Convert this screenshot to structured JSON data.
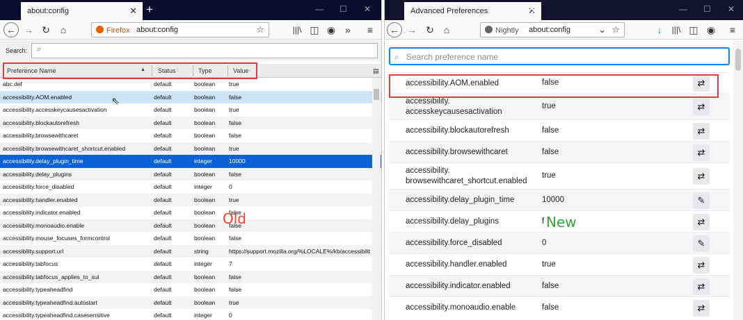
{
  "left": {
    "tab_title": "about:config",
    "brand": "Firefox",
    "url": "about:config",
    "search_label": "Search:",
    "columns": [
      "Preference Name",
      "Status",
      "Type",
      "Value"
    ],
    "rows": [
      [
        "abc.def",
        "default",
        "boolean",
        "true"
      ],
      [
        "accessibility.AOM.enabled",
        "default",
        "boolean",
        "false"
      ],
      [
        "accessibility.accesskeycausesactivation",
        "default",
        "boolean",
        "true"
      ],
      [
        "accessibility.blockautorefresh",
        "default",
        "boolean",
        "false"
      ],
      [
        "accessibility.browsewithcaret",
        "default",
        "boolean",
        "false"
      ],
      [
        "accessibility.browsewithcaret_shortcut.enabled",
        "default",
        "boolean",
        "true"
      ],
      [
        "accessibility.delay_plugin_time",
        "default",
        "integer",
        "10000"
      ],
      [
        "accessibility.delay_plugins",
        "default",
        "boolean",
        "false"
      ],
      [
        "accessibility.force_disabled",
        "default",
        "integer",
        "0"
      ],
      [
        "accessibility.handler.enabled",
        "default",
        "boolean",
        "true"
      ],
      [
        "accessibility.indicator.enabled",
        "default",
        "boolean",
        "false"
      ],
      [
        "accessibility.monoaudio.enable",
        "default",
        "boolean",
        "false"
      ],
      [
        "accessibility.mouse_focuses_formcontrol",
        "default",
        "boolean",
        "false"
      ],
      [
        "accessibility.support.url",
        "default",
        "string",
        "https://support.mozilla.org/%LOCALE%/kb/accessibility"
      ],
      [
        "accessibility.tabfocus",
        "default",
        "integer",
        "7"
      ],
      [
        "accessibility.tabfocus_applies_to_xul",
        "default",
        "boolean",
        "false"
      ],
      [
        "accessibility.typeaheadfind",
        "default",
        "boolean",
        "false"
      ],
      [
        "accessibility.typeaheadfind.autostart",
        "default",
        "boolean",
        "true"
      ],
      [
        "accessibility.typeaheadfind.casesensitive",
        "default",
        "integer",
        "0"
      ]
    ],
    "label": "Old"
  },
  "right": {
    "tab_title": "Advanced Preferences",
    "brand": "Nightly",
    "url": "about:config",
    "search_placeholder": "Search preference name",
    "rows": [
      {
        "name": "accessibility.AOM.enabled",
        "value": "false",
        "icon": "toggle-icon"
      },
      {
        "name": "accessibility.\naccesskeycausesactivation",
        "value": "true",
        "icon": "toggle-icon"
      },
      {
        "name": "accessibility.blockautorefresh",
        "value": "false",
        "icon": "toggle-icon"
      },
      {
        "name": "accessibility.browsewithcaret",
        "value": "false",
        "icon": "toggle-icon"
      },
      {
        "name": "accessibility.\nbrowsewithcaret_shortcut.enabled",
        "value": "true",
        "icon": "toggle-icon"
      },
      {
        "name": "accessibility.delay_plugin_time",
        "value": "10000",
        "icon": "pencil-icon"
      },
      {
        "name": "accessibility.delay_plugins",
        "value": "f",
        "icon": "toggle-icon"
      },
      {
        "name": "accessibility.force_disabled",
        "value": "0",
        "icon": "pencil-icon"
      },
      {
        "name": "accessibility.handler.enabled",
        "value": "true",
        "icon": "toggle-icon"
      },
      {
        "name": "accessibility.indicator.enabled",
        "value": "false",
        "icon": "toggle-icon"
      },
      {
        "name": "accessibility.monoaudio.enable",
        "value": "false",
        "icon": "toggle-icon"
      }
    ],
    "label": "New"
  },
  "colors": {
    "highlight": "#e03c3c",
    "old_label": "#e8452c",
    "new_label": "#3aa33a",
    "selection": "#0a62d6",
    "focus": "#0a84ff"
  }
}
